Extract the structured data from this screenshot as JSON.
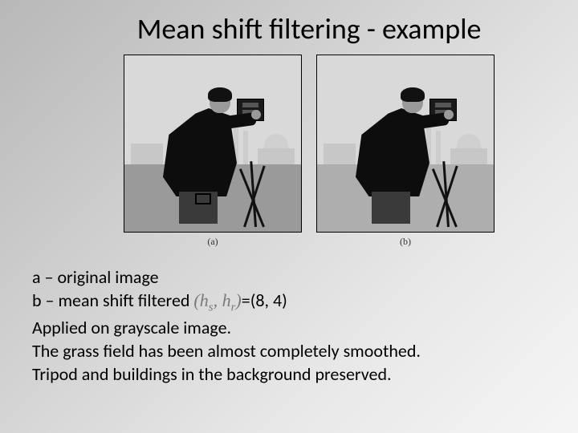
{
  "title": "Mean shift filtering - example",
  "figure": {
    "caption_a": "(a)",
    "caption_b": "(b)"
  },
  "desc": {
    "line1_a": "a – original image",
    "line2_b_prefix": "b – mean shift filtered ",
    "line2_paren_open": "(",
    "line2_hs": "h",
    "line2_hs_sub": "s",
    "line2_comma": ", ",
    "line2_hr": "h",
    "line2_hr_sub": "r",
    "line2_paren_close": ")",
    "line2_eq": "=(8, 4)",
    "line3": "Applied on grayscale image.",
    "line4": "The grass field has been almost completely smoothed.",
    "line5": "Tripod and buildings in the background preserved."
  }
}
